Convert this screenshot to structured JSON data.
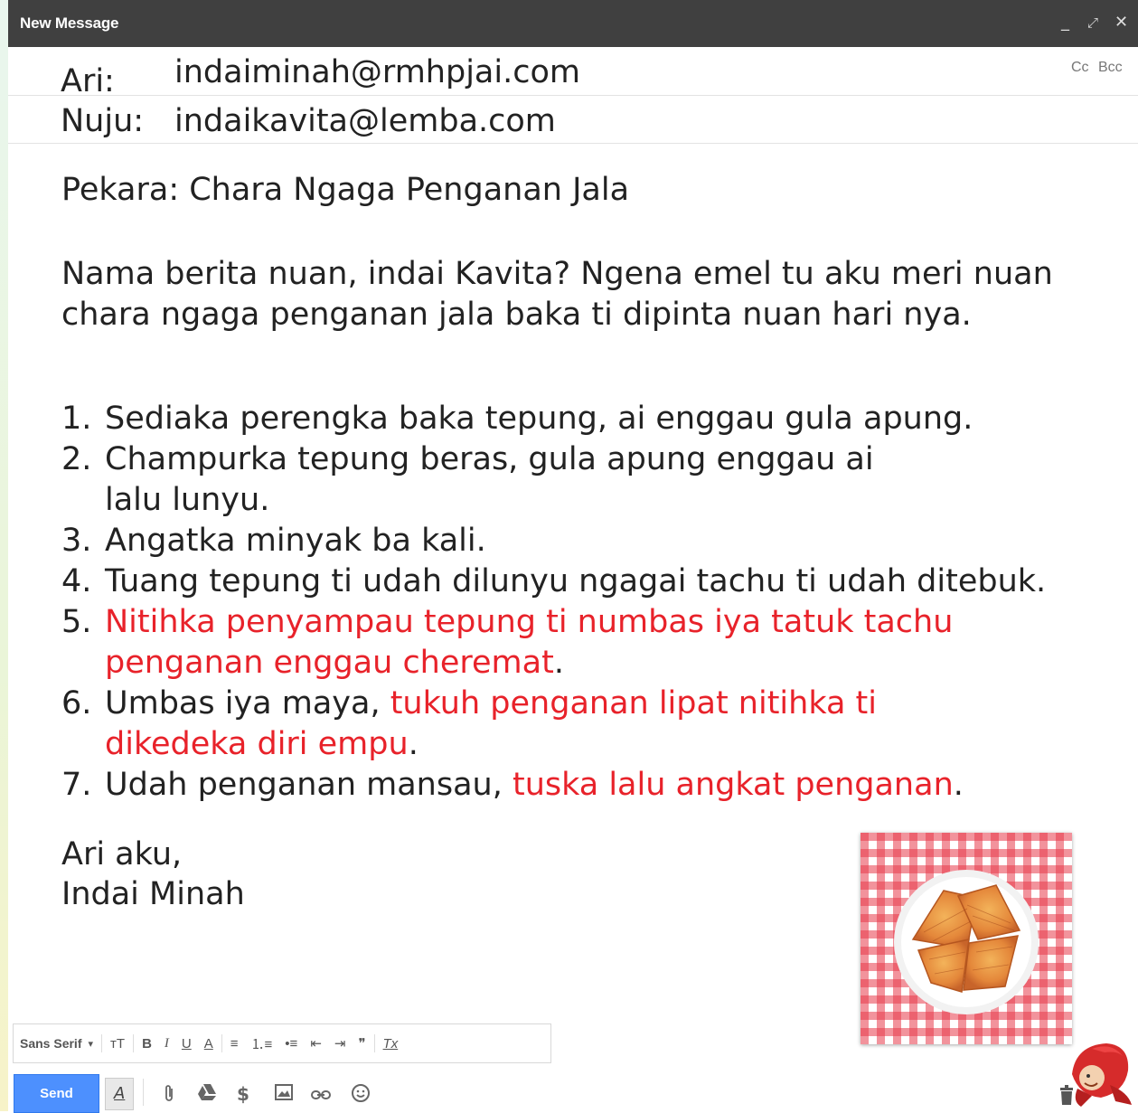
{
  "window": {
    "title": "New Message",
    "minimize_label": "_",
    "popout_label": "⤢",
    "close_label": "✕"
  },
  "header": {
    "from_label": "Ari:",
    "from_value": "indaiminah@rmhpjai.com",
    "to_label": "Nuju:",
    "to_value": "indaikavita@lemba.com",
    "cc_label": "Cc",
    "bcc_label": "Bcc"
  },
  "message": {
    "subject": "Pekara: Chara Ngaga Penganan Jala",
    "intro_line1": "Nama berita nuan, indai Kavita? Ngena emel tu aku meri nuan",
    "intro_line2": "chara ngaga penganan jala baka ti dipinta nuan hari nya.",
    "steps": [
      {
        "num": "1.",
        "plain": "Sediaka perengka baka tepung, ai enggau gula apung."
      },
      {
        "num": "2.",
        "plain": "Champurka tepung beras, gula apung enggau ai",
        "plain2": "lalu lunyu."
      },
      {
        "num": "3.",
        "plain": "Angatka minyak ba kali."
      },
      {
        "num": "4.",
        "plain": "Tuang tepung ti udah dilunyu ngagai tachu ti udah ditebuk."
      },
      {
        "num": "5.",
        "red": "Nitihka penyampau tepung ti numbas iya tatuk tachu",
        "red2": "penganan enggau cheremat",
        "tail": "."
      },
      {
        "num": "6.",
        "plain": "Umbas iya maya, ",
        "red": "tukuh penganan lipat nitihka ti",
        "red2": "dikedeka diri empu",
        "tail": "."
      },
      {
        "num": "7.",
        "plain": "Udah penganan mansau, ",
        "red": "tuska lalu angkat penganan",
        "tail": "."
      }
    ],
    "signoff_line1": "Ari aku,",
    "signoff_line2": "Indai Minah"
  },
  "toolbar": {
    "font_name": "Sans Serif",
    "font_dropdown": "▾",
    "size_label": "ᴛT",
    "bold": "B",
    "italic": "I",
    "underline": "U",
    "text_color": "A",
    "align": "≡",
    "numbered_list": "⒈≡",
    "bulleted_list": "•≡",
    "indent_less": "⇤",
    "indent_more": "⇥",
    "quote": "❞",
    "clear_format": "Tx"
  },
  "actions": {
    "send_label": "Send",
    "format_label": "A",
    "attach_icon": "paperclip-icon",
    "drive_icon": "drive-icon",
    "money_label": "$",
    "photo_icon": "insert-photo-icon",
    "link_icon": "link-icon",
    "emoji_icon": "emoji-icon",
    "trash_icon": "trash-icon"
  },
  "colors": {
    "title_bar": "#404040",
    "highlight_red": "#e8222a",
    "send_blue": "#4d90fe",
    "tablecloth_red": "#e63a4a"
  }
}
